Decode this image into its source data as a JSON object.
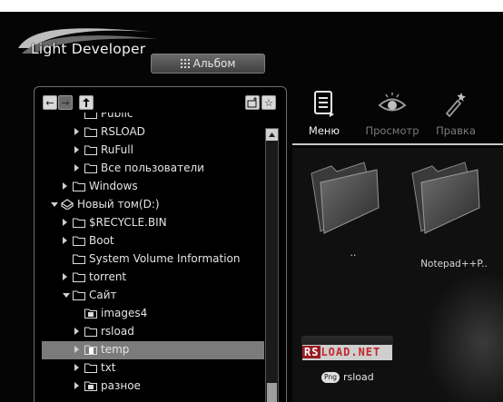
{
  "app": {
    "logo_text": "Light Developer",
    "album_button": "Альбом"
  },
  "tree": {
    "rows": [
      {
        "label": "Public",
        "depth": 2,
        "arrow": "none",
        "icon": "folder-icon"
      },
      {
        "label": "RSLOAD",
        "depth": 2,
        "arrow": "closed",
        "icon": "folder-icon"
      },
      {
        "label": "RuFull",
        "depth": 2,
        "arrow": "closed",
        "icon": "folder-icon"
      },
      {
        "label": "Все пользователи",
        "depth": 2,
        "arrow": "closed",
        "icon": "folder-icon"
      },
      {
        "label": "Windows",
        "depth": 1,
        "arrow": "closed",
        "icon": "folder-icon"
      },
      {
        "label": "Новый том(D:)",
        "depth": 0,
        "arrow": "open",
        "icon": "drive-icon"
      },
      {
        "label": "$RECYCLE.BIN",
        "depth": 1,
        "arrow": "closed",
        "icon": "folder-icon"
      },
      {
        "label": "Boot",
        "depth": 1,
        "arrow": "closed",
        "icon": "folder-icon"
      },
      {
        "label": "System Volume Information",
        "depth": 1,
        "arrow": "none",
        "icon": "folder-icon"
      },
      {
        "label": "torrent",
        "depth": 1,
        "arrow": "closed",
        "icon": "folder-icon"
      },
      {
        "label": "Сайт",
        "depth": 1,
        "arrow": "open",
        "icon": "folder-icon"
      },
      {
        "label": "images4",
        "depth": 2,
        "arrow": "none",
        "icon": "image-folder-icon"
      },
      {
        "label": "rsload",
        "depth": 2,
        "arrow": "closed",
        "icon": "folder-icon"
      },
      {
        "label": "temp",
        "depth": 2,
        "arrow": "closed",
        "icon": "file-folder-icon",
        "selected": true
      },
      {
        "label": "txt",
        "depth": 2,
        "arrow": "closed",
        "icon": "folder-icon"
      },
      {
        "label": "разное",
        "depth": 2,
        "arrow": "closed",
        "icon": "image-folder-icon"
      }
    ]
  },
  "toolbar": {
    "tools": [
      {
        "label": "Меню",
        "icon": "menu-document-icon",
        "active": true
      },
      {
        "label": "Просмотр",
        "icon": "eye-icon",
        "active": false
      },
      {
        "label": "Правка",
        "icon": "edit-wand-icon",
        "active": false
      }
    ]
  },
  "files": {
    "items": [
      {
        "label": "..",
        "icon": "folder-icon"
      },
      {
        "label": "Notepad++P..",
        "icon": "folder-icon"
      }
    ],
    "image": {
      "banner_left": "RS",
      "banner_right": "LOAD.NET",
      "badge": "Png",
      "label": "rsload"
    }
  },
  "colors": {
    "background": "#050505",
    "selected_row": "#7b7b7b",
    "text": "#e4e4e4",
    "muted_text": "#7a7a7a"
  }
}
